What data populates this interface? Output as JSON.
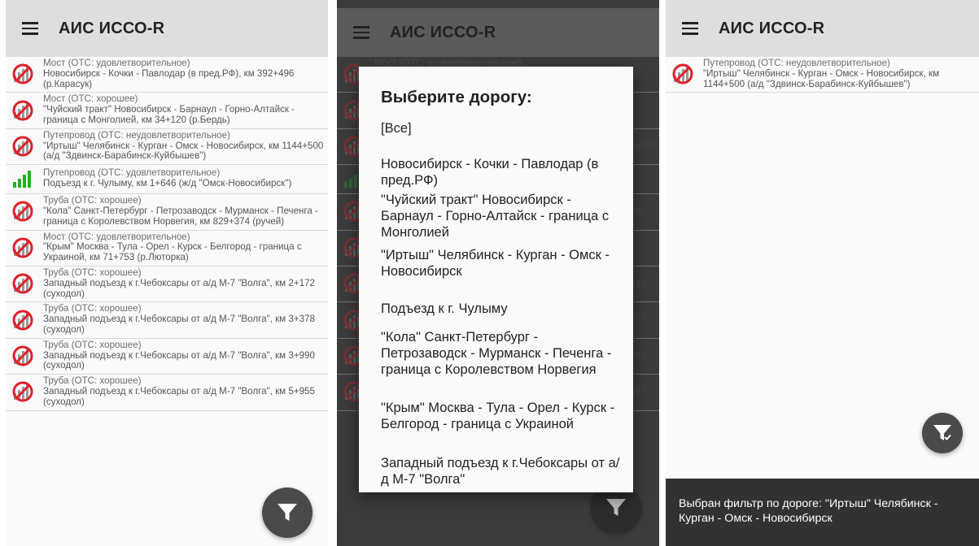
{
  "app": {
    "title": "АИС ИССО-R"
  },
  "list": [
    {
      "title": "Мост (ОТС: удовлетворительное)",
      "desc": "Новосибирск - Кочки - Павлодар (в пред.РФ), км 392+496 (р.Карасук)",
      "icon": "no-signal-icon"
    },
    {
      "title": "Мост (ОТС: хорошее)",
      "desc": "\"Чуйский тракт\" Новосибирск - Барнаул - Горно-Алтайск - граница с Монголией, км 34+120 (р.Бердь)",
      "icon": "no-signal-icon"
    },
    {
      "title": "Путепровод (ОТС: неудовлетворительное)",
      "desc": "\"Иртыш\" Челябинск - Курган - Омск - Новосибирск, км 1144+500 (а/д \"Здвинск-Барабинск-Куйбышев\")",
      "icon": "no-signal-icon"
    },
    {
      "title": "Путепровод (ОТС: удовлетворительное)",
      "desc": "Подъезд к г. Чулыму, км 1+646 (ж/д \"Омск-Новосибирск\")",
      "icon": "signal-bars-icon"
    },
    {
      "title": "Труба (ОТС: хорошее)",
      "desc": "\"Кола\" Санкт-Петербург - Петрозаводск - Мурманск - Печенга - граница с Королевством Норвегия, км 829+374 (ручей)",
      "icon": "no-signal-icon"
    },
    {
      "title": "Мост (ОТС: удовлетворительное)",
      "desc": "\"Крым\" Москва - Тула - Орел - Курск - Белгород - граница с Украиной, км 71+753 (р.Лютор­ка)",
      "icon": "no-signal-icon"
    },
    {
      "title": "Труба (ОТС: хорошее)",
      "desc": "Западный подъезд к г.Чебоксары от а/д М-7 \"Волга\", км 2+172 (суходол)",
      "icon": "no-signal-icon"
    },
    {
      "title": "Труба (ОТС: хорошее)",
      "desc": "Западный подъезд к г.Чебоксары от а/д М-7 \"Волга\", км 3+378 (суходол)",
      "icon": "no-signal-icon"
    },
    {
      "title": "Труба (ОТС: хорошее)",
      "desc": "Западный подъезд к г.Чебоксары от а/д М-7 \"Волга\", км 3+990 (суходол)",
      "icon": "no-signal-icon"
    },
    {
      "title": "Труба (ОТС: хорошее)",
      "desc": "Западный подъезд к г.Чебоксары от а/д М-7 \"Волга\", км 5+955 (суходол)",
      "icon": "no-signal-icon"
    }
  ],
  "dialog": {
    "title": "Выберите дорогу:",
    "options": [
      "[Все]",
      "Новосибирск - Кочки - Павлодар (в пред.РФ)",
      "\"Чуйский тракт\" Новосибирск - Барнаул - Горно-Алтайск - граница с Монголией",
      "\"Иртыш\" Челябинск - Курган - Омск - Новосибирск",
      "Подъезд к г. Чулыму",
      "\"Кола\" Санкт-Петербург - Петрозаводск - Мурманск - Печенга - граница с Королевством Норвегия",
      "\"Крым\" Москва - Тула - Орел - Курск - Белгород - граница с Украиной",
      "Западный подъезд к г.Чебоксары от а/д М-7 \"Волга\""
    ]
  },
  "filtered_list": [
    {
      "title": "Путепровод (ОТС: неудовлетворительное)",
      "desc": "\"Иртыш\" Челябинск - Курган - Омск - Новосибирск, км 1144+500 (а/д \"Здвинск-Барабинск-Куйбышев\")",
      "icon": "no-signal-icon"
    }
  ],
  "snackbar": {
    "text": "Выбран фильтр по дороге: \"Иртыш\" Челябинск - Курган - Омск - Новосибирск"
  },
  "colors": {
    "appbar": "#dedede",
    "fab": "#4a4a4a",
    "signal_green": "#1db21d",
    "no_signal_red": "#e0202a",
    "snackbar": "#323232"
  },
  "icons": {
    "menu": "hamburger-icon",
    "filter": "filter-icon",
    "filter_active": "filter-check-icon"
  }
}
